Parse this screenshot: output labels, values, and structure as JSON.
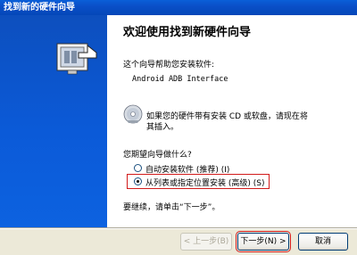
{
  "window": {
    "title": "找到新的硬件向导"
  },
  "content": {
    "heading": "欢迎使用找到新硬件向导",
    "intro": "这个向导帮助您安装软件:",
    "device": "Android ADB Interface",
    "cd_hint_line1": "如果您的硬件带有安装 CD 或软盘，请现在将",
    "cd_hint_line2": "其插入。",
    "question": "您期望向导做什么?",
    "options": [
      {
        "label": "自动安装软件 (推荐) (I)",
        "selected": false
      },
      {
        "label": "从列表或指定位置安装 (高级) (S)",
        "selected": true
      }
    ],
    "continue_hint": "要继续，请单击“下一步”。"
  },
  "buttons": {
    "back": "< 上一步(B)",
    "next": "下一步(N) >",
    "cancel": "取消"
  },
  "colors": {
    "titlebar": "#0a4fc8",
    "banner": "#0b5ad8",
    "highlight": "#d21b1b",
    "dialog_bg": "#ece9d8"
  },
  "icons": [
    "hardware-wizard-icon",
    "cd-disc-icon"
  ]
}
